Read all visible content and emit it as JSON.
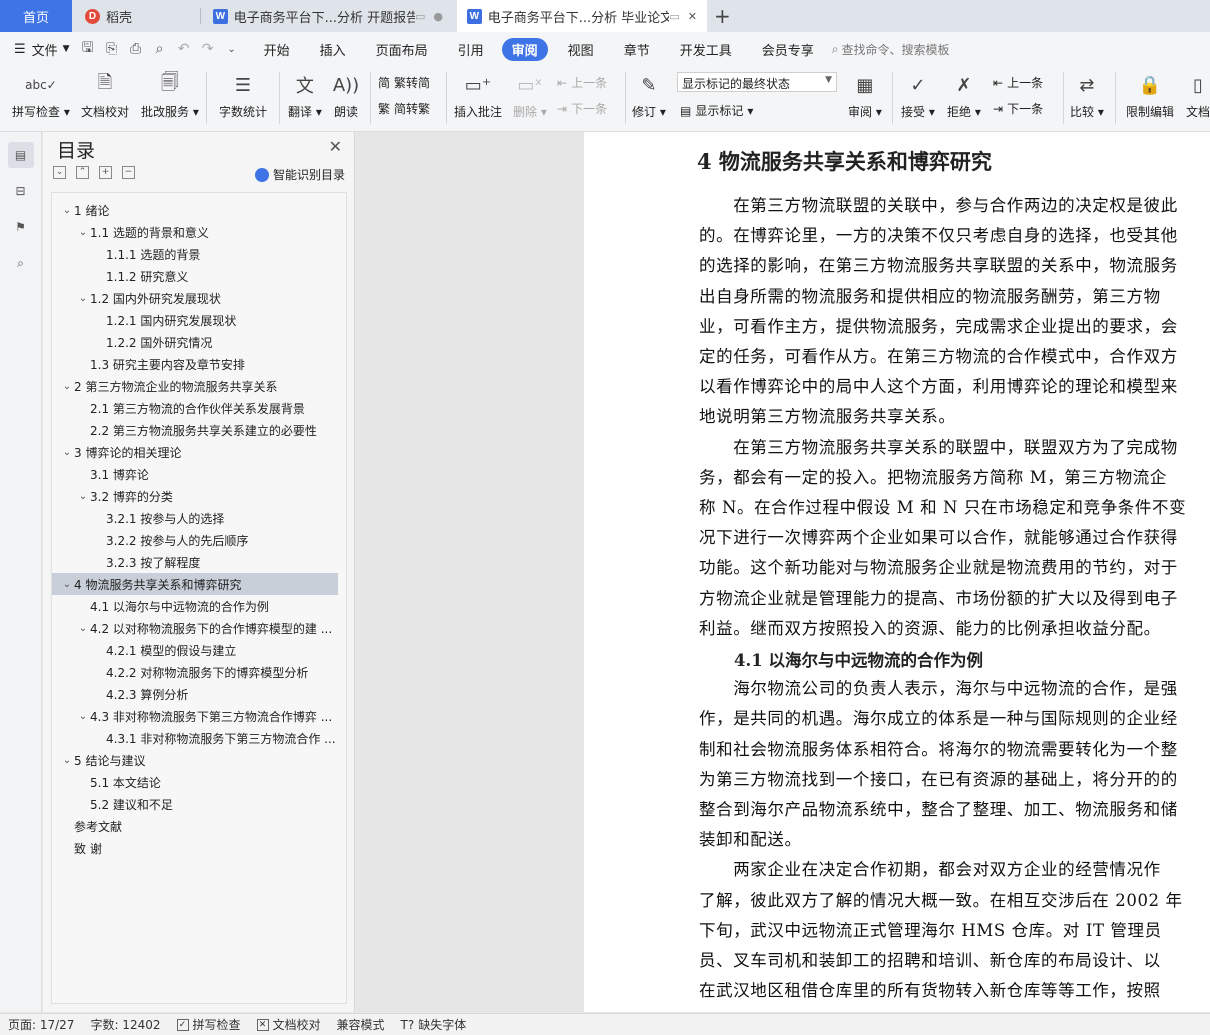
{
  "tabs": [
    {
      "label": "首页"
    },
    {
      "label": "稻壳"
    },
    {
      "label": "电子商务平台下...分析 开题报告"
    },
    {
      "label": "电子商务平台下...分析 毕业论文"
    }
  ],
  "menu": {
    "file": "文件",
    "items": [
      "开始",
      "插入",
      "页面布局",
      "引用",
      "审阅",
      "视图",
      "章节",
      "开发工具",
      "会员专享"
    ],
    "active": "审阅",
    "search": "查找命令、搜索模板"
  },
  "ribbon": {
    "spell": "拼写检查",
    "proof": "文档校对",
    "annotate": "批改服务",
    "wordcount": "字数统计",
    "translate": "翻译",
    "read": "朗读",
    "trad": "繁转简",
    "simp": "简转繁",
    "insert_comment": "插入批注",
    "delete": "删除",
    "prev": "上一条",
    "next": "下一条",
    "revise": "修订",
    "markup_state": "显示标记的最终状态",
    "show_markup": "显示标记",
    "review": "审阅",
    "accept": "接受",
    "reject": "拒绝",
    "prev2": "上一条",
    "next2": "下一条",
    "compare": "比较",
    "restrict": "限制编辑",
    "doc_clipped": "文档"
  },
  "toc": {
    "title": "目录",
    "smart": "智能识别目录",
    "items": [
      {
        "label": "1 绪论",
        "level": 0,
        "caret": true
      },
      {
        "label": "1.1 选题的背景和意义",
        "level": 1,
        "caret": true
      },
      {
        "label": "1.1.1 选题的背景",
        "level": 2,
        "caret": false
      },
      {
        "label": "1.1.2 研究意义",
        "level": 2,
        "caret": false
      },
      {
        "label": "1.2 国内外研究发展现状",
        "level": 1,
        "caret": true
      },
      {
        "label": "1.2.1 国内研究发展现状",
        "level": 2,
        "caret": false
      },
      {
        "label": "1.2.2 国外研究情况",
        "level": 2,
        "caret": false
      },
      {
        "label": "1.3 研究主要内容及章节安排",
        "level": 1,
        "caret": false
      },
      {
        "label": "2 第三方物流企业的物流服务共享关系",
        "level": 0,
        "caret": true
      },
      {
        "label": "2.1 第三方物流的合作伙伴关系发展背景",
        "level": 1,
        "caret": false
      },
      {
        "label": "2.2 第三方物流服务共享关系建立的必要性",
        "level": 1,
        "caret": false
      },
      {
        "label": "3 博弈论的相关理论",
        "level": 0,
        "caret": true
      },
      {
        "label": "3.1 博弈论",
        "level": 1,
        "caret": false
      },
      {
        "label": "3.2 博弈的分类",
        "level": 1,
        "caret": true
      },
      {
        "label": "3.2.1 按参与人的选择",
        "level": 2,
        "caret": false
      },
      {
        "label": "3.2.2 按参与人的先后顺序",
        "level": 2,
        "caret": false
      },
      {
        "label": "3.2.3 按了解程度",
        "level": 2,
        "caret": false
      },
      {
        "label": "4 物流服务共享关系和博弈研究",
        "level": 0,
        "caret": true,
        "selected": true
      },
      {
        "label": "4.1 以海尔与中远物流的合作为例",
        "level": 1,
        "caret": false
      },
      {
        "label": "4.2 以对称物流服务下的合作博弈模型的建 ...",
        "level": 1,
        "caret": true
      },
      {
        "label": "4.2.1 模型的假设与建立",
        "level": 2,
        "caret": false
      },
      {
        "label": "4.2.2 对称物流服务下的博弈模型分析",
        "level": 2,
        "caret": false
      },
      {
        "label": "4.2.3 算例分析",
        "level": 2,
        "caret": false
      },
      {
        "label": "4.3 非对称物流服务下第三方物流合作博弈 ...",
        "level": 1,
        "caret": true
      },
      {
        "label": "4.3.1 非对称物流服务下第三方物流合作 ...",
        "level": 2,
        "caret": false
      },
      {
        "label": "5 结论与建议",
        "level": 0,
        "caret": true
      },
      {
        "label": "5.1 本文结论",
        "level": 1,
        "caret": false
      },
      {
        "label": "5.2 建议和不足",
        "level": 1,
        "caret": false
      },
      {
        "label": "参考文献",
        "level": 0,
        "caret": false
      },
      {
        "label": "致  谢",
        "level": 0,
        "caret": false
      }
    ]
  },
  "document": {
    "heading": "4 物流服务共享关系和博弈研究",
    "para1": [
      "　　在第三方物流联盟的关联中，参与合作两边的决定权是彼此",
      "的。在博弈论里，一方的决策不仅只考虑自身的选择，也受其他",
      "的选择的影响，在第三方物流服务共享联盟的关系中，物流服务",
      "出自身所需的物流服务和提供相应的物流服务酬劳，第三方物",
      "业，可看作主方，提供物流服务，完成需求企业提出的要求，会",
      "定的任务，可看作从方。在第三方物流的合作模式中，合作双方",
      "以看作博弈论中的局中人这个方面，利用博弈论的理论和模型来",
      "地说明第三方物流服务共享关系。"
    ],
    "para2": [
      "　　在第三方物流服务共享关系的联盟中，联盟双方为了完成物",
      "务，都会有一定的投入。把物流服务方简称 M，第三方物流企",
      "称 N。在合作过程中假设 M 和 N 只在市场稳定和竞争条件不变",
      "况下进行一次博弈两个企业如果可以合作，就能够通过合作获得",
      "功能。这个新功能对与物流服务企业就是物流费用的节约，对于",
      "方物流企业就是管理能力的提高、市场份额的扩大以及得到电子",
      "利益。继而双方按照投入的资源、能力的比例承担收益分配。"
    ],
    "subheading": "4.1 以海尔与中远物流的合作为例",
    "para3": [
      "　　海尔物流公司的负责人表示，海尔与中远物流的合作，是强",
      "作，是共同的机遇。海尔成立的体系是一种与国际规则的企业经",
      "制和社会物流服务体系相符合。将海尔的物流需要转化为一个整",
      "为第三方物流找到一个接口，在已有资源的基础上，将分开的的",
      "整合到海尔产品物流系统中，整合了整理、加工、物流服务和储",
      "装卸和配送。"
    ],
    "para4": [
      "　　两家企业在决定合作初期，都会对双方企业的经营情况作",
      "了解，彼此双方了解的情况大概一致。在相互交涉后在 2002 年",
      "下旬，武汉中远物流正式管理海尔 HMS 仓库。对 IT 管理员",
      "员、叉车司机和装卸工的招聘和培训、新仓库的布局设计、以",
      "在武汉地区租借仓库里的所有货物转入新仓库等等工作，按照"
    ]
  },
  "status": {
    "page": "页面: 17/27",
    "words": "字数: 12402",
    "spell": "拼写检查",
    "proof": "文档校对",
    "compat": "兼容模式",
    "missing_font": "缺失字体"
  }
}
